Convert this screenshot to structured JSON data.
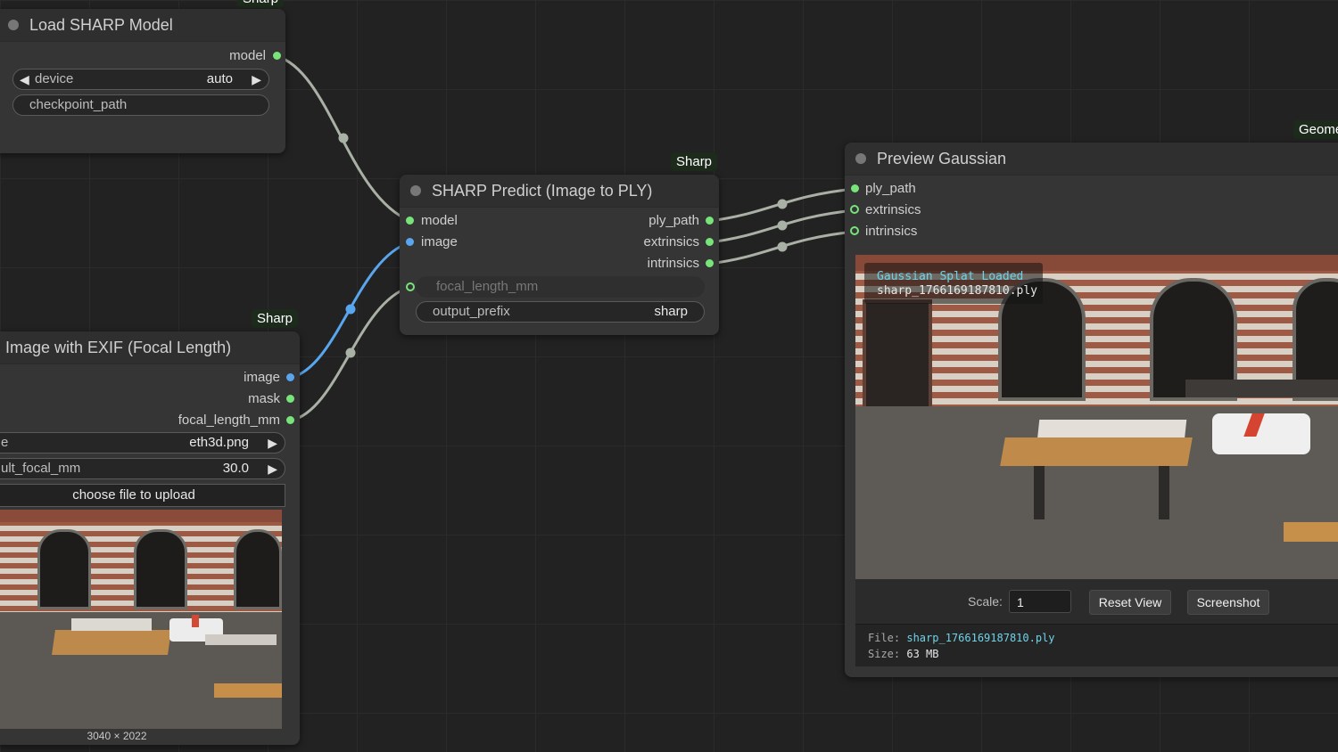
{
  "colors": {
    "canvas": "#222222",
    "node": "#353535",
    "title_bar": "#2f2f2f",
    "slot_green": "#78e47a",
    "slot_blue": "#5aa6ee",
    "wire_gray": "#a9b0a5",
    "wire_blue": "#5aa6ee",
    "mono_accent": "#6fd3e8"
  },
  "top_badge_partial": "Sharp",
  "load_model": {
    "title": "Load SHARP Model",
    "outputs": [
      "model"
    ],
    "device_label": "device",
    "device_value": "auto",
    "checkpoint_label": "checkpoint_path"
  },
  "load_image": {
    "badge": "Sharp",
    "title": "Image with EXIF (Focal Length)",
    "outputs": [
      "image",
      "mask",
      "focal_length_mm"
    ],
    "image_label": "e",
    "image_value": "eth3d.png",
    "focal_label": "ult_focal_mm",
    "focal_value": "30.0",
    "upload_label": "choose file to upload",
    "dimensions": "3040 × 2022"
  },
  "predict": {
    "badge": "Sharp",
    "title": "SHARP Predict (Image to PLY)",
    "inputs": [
      "model",
      "image"
    ],
    "outputs": [
      "ply_path",
      "extrinsics",
      "intrinsics"
    ],
    "focal_label": "focal_length_mm",
    "prefix_label": "output_prefix",
    "prefix_value": "sharp"
  },
  "preview": {
    "badge": "Geome",
    "title": "Preview Gaussian",
    "inputs": [
      "ply_path",
      "extrinsics",
      "intrinsics"
    ],
    "overlay_title": "Gaussian Splat Loaded",
    "overlay_file": "sharp_1766169187810.ply",
    "scale_label": "Scale:",
    "scale_value": "1",
    "reset_label": "Reset View",
    "screenshot_label": "Screenshot",
    "file_label": "File:",
    "file_value": "sharp_1766169187810.ply",
    "size_label": "Size:",
    "size_value": "63 MB"
  }
}
